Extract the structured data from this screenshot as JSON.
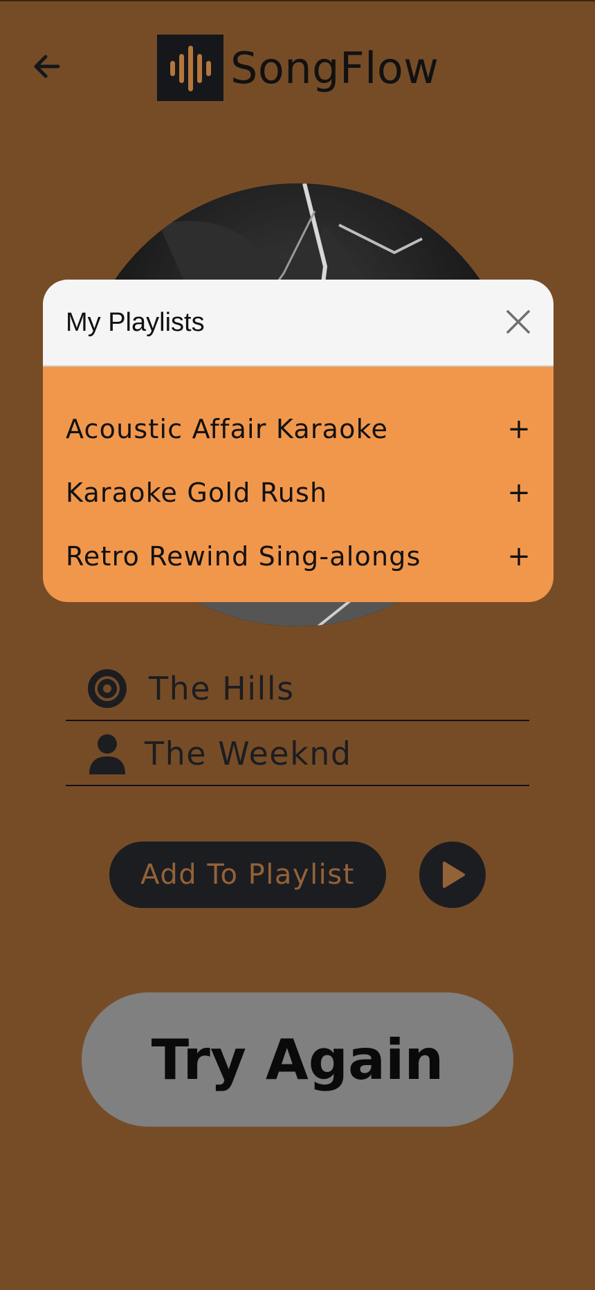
{
  "app": {
    "name": "SongFlow"
  },
  "header": {
    "back_icon": "arrow-left-icon",
    "logo_icon": "sound-wave-icon"
  },
  "song": {
    "title": "The Hills",
    "artist": "The Weeknd",
    "title_icon": "disc-icon",
    "artist_icon": "person-icon"
  },
  "actions": {
    "add_to_playlist_label": "Add To Playlist",
    "play_icon": "play-icon",
    "try_again_label": "Try Again"
  },
  "modal": {
    "title": "My Playlists",
    "close_icon": "close-icon",
    "playlists": [
      {
        "name": "Acoustic Affair Karaoke",
        "action": "+"
      },
      {
        "name": "Karaoke Gold Rush",
        "action": "+"
      },
      {
        "name": "Retro Rewind Sing-alongs",
        "action": "+"
      }
    ]
  },
  "colors": {
    "background": "#764c27",
    "modal_body": "#f1974c",
    "modal_header": "#f5f5f5",
    "dark_button": "#1c1d21",
    "button_text": "#946238",
    "try_again_button": "#808080"
  }
}
